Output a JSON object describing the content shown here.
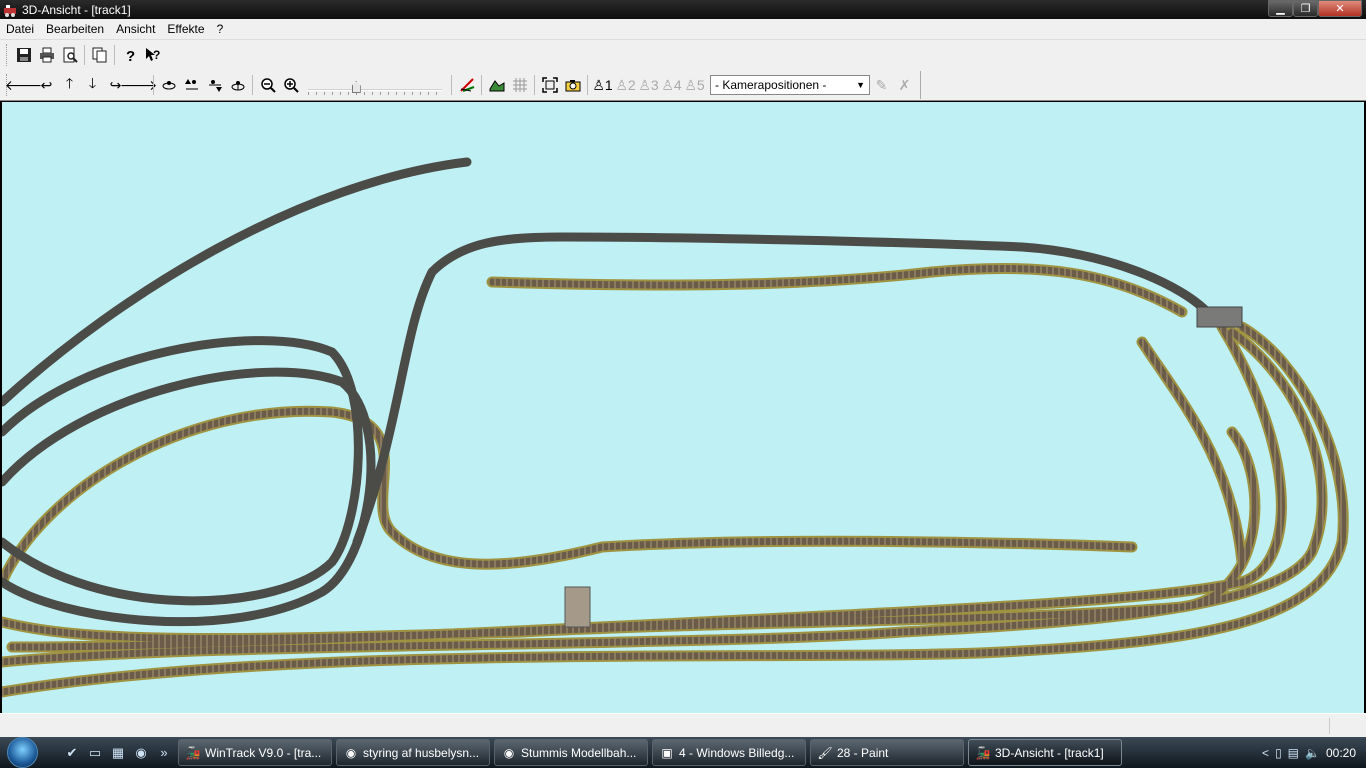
{
  "window": {
    "title": "3D-Ansicht - [track1]",
    "minimize_glyph": "▁",
    "maximize_glyph": "❐",
    "close_glyph": "✕"
  },
  "menu": [
    "Datei",
    "Bearbeiten",
    "Ansicht",
    "Effekte",
    "?"
  ],
  "toolbar1": {
    "icons": [
      "save-icon",
      "print-icon",
      "print-preview-icon",
      "copy-icon",
      "help-icon",
      "context-help-icon"
    ]
  },
  "toolbar2": {
    "nav_icons": [
      "arrow-left-icon",
      "turn-left-icon",
      "arrow-up-icon",
      "arrow-down-icon",
      "turn-right-icon",
      "arrow-right-icon"
    ],
    "camera_labels": [
      "1",
      "2",
      "3",
      "4",
      "5"
    ],
    "camera_select": "- Kamerapositionen -",
    "zoom_slider_value": 0.35
  },
  "viewport": {
    "background": "#bff0f3",
    "track_color": "#5b4e3e",
    "ballast_color": "#9c8a2f"
  },
  "taskbar": {
    "tasks": [
      {
        "label": "WinTrack  V9.0 - [tra...",
        "icon": "wintrack-icon"
      },
      {
        "label": "styring af husbelysn...",
        "icon": "chrome-icon"
      },
      {
        "label": "Stummis Modellbah...",
        "icon": "chrome-icon"
      },
      {
        "label": "4 - Windows Billedg...",
        "icon": "photo-gallery-icon"
      },
      {
        "label": "28 - Paint",
        "icon": "paint-icon"
      },
      {
        "label": "3D-Ansicht - [track1]",
        "icon": "wintrack-icon"
      }
    ],
    "clock": "00:20",
    "tray_arrow": "<",
    "quicklaunch_more": "»"
  }
}
